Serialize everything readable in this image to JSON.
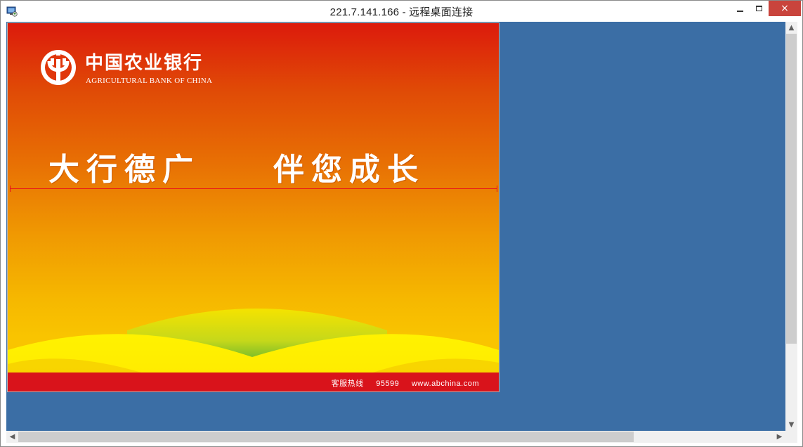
{
  "window": {
    "title": "221.7.141.166 - 远程桌面连接",
    "app_icon": "remote-desktop-icon",
    "controls": {
      "minimize": "minimize-icon",
      "maximize": "maximize-icon",
      "close": "×"
    }
  },
  "remote_screen": {
    "bank_name_cn": "中国农业银行",
    "bank_name_en": "AGRICULTURAL BANK OF CHINA",
    "slogan_part1": "大行德广",
    "slogan_part2": "伴您成长",
    "footer": {
      "hotline_label": "客服热线",
      "hotline_number": "95599",
      "website": "www.abchina.com"
    }
  },
  "colors": {
    "remote_background": "#3b6ea5",
    "brand_red": "#d9131b",
    "close_button": "#c9443c"
  },
  "scrollbars": {
    "up_arrow": "▲",
    "down_arrow": "▼",
    "left_arrow": "◀",
    "right_arrow": "▶"
  }
}
